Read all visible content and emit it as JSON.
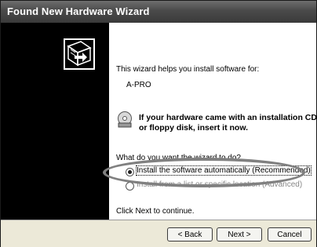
{
  "window": {
    "title": "Found New Hardware Wizard"
  },
  "content": {
    "intro": "This wizard helps you install software for:",
    "device": "A-PRO",
    "cd_prompt_line1": "If your hardware came with an installation CD",
    "cd_prompt_line2": "or floppy disk, insert it now.",
    "question": "What do you want the wizard to do?",
    "option_auto": "Install the software automatically (Recommended)",
    "option_manual": "Install from a list or specific location (Advanced)",
    "continue_hint": "Click Next to continue."
  },
  "buttons": {
    "back": "< Back",
    "next": "Next >",
    "cancel": "Cancel"
  },
  "icons": [
    "hardware-wizard-icon",
    "cd-drive-icon"
  ],
  "colors": {
    "titlebar": "#4a4a4a",
    "left_panel": "#000000",
    "annotation_ellipse": "#808080"
  }
}
